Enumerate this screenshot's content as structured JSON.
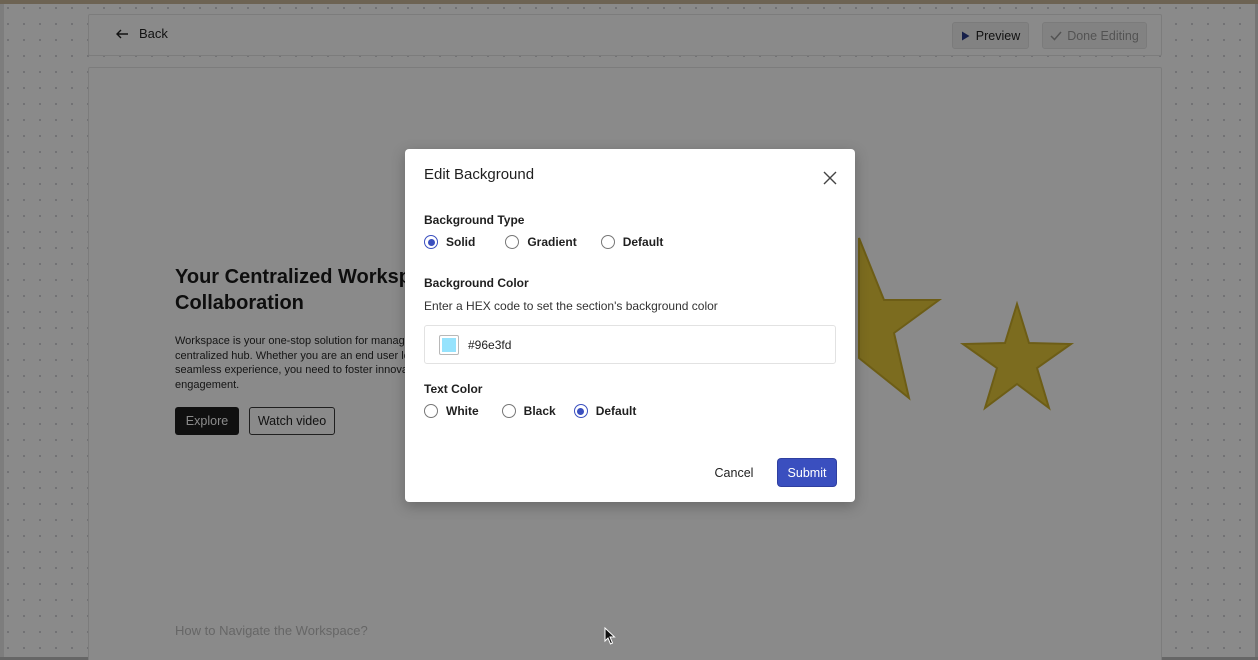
{
  "toolbar": {
    "back_label": "Back",
    "preview_label": "Preview",
    "done_label": "Done Editing"
  },
  "hero": {
    "title": "Your Centralized Workspace for Collaboration",
    "description": "Workspace is your one-stop solution for managing members in a centralized hub. Whether you are an end user looking for a seamless experience, you need to foster innovation and engagement.",
    "explore_label": "Explore",
    "watch_label": "Watch video",
    "nav_heading": "How to Navigate the Workspace?"
  },
  "modal": {
    "title": "Edit Background",
    "background_type": {
      "label": "Background Type",
      "options": [
        "Solid",
        "Gradient",
        "Default"
      ],
      "selected": "Solid"
    },
    "background_color": {
      "label": "Background Color",
      "helper": "Enter a HEX code to set the section's background color",
      "value": "#96e3fd"
    },
    "text_color": {
      "label": "Text Color",
      "options": [
        "White",
        "Black",
        "Default"
      ],
      "selected": "Default"
    },
    "cancel_label": "Cancel",
    "submit_label": "Submit"
  },
  "colors": {
    "accent": "#3a4fbf",
    "star": "#e5c83a",
    "dark_button": "#1f1f1f"
  }
}
